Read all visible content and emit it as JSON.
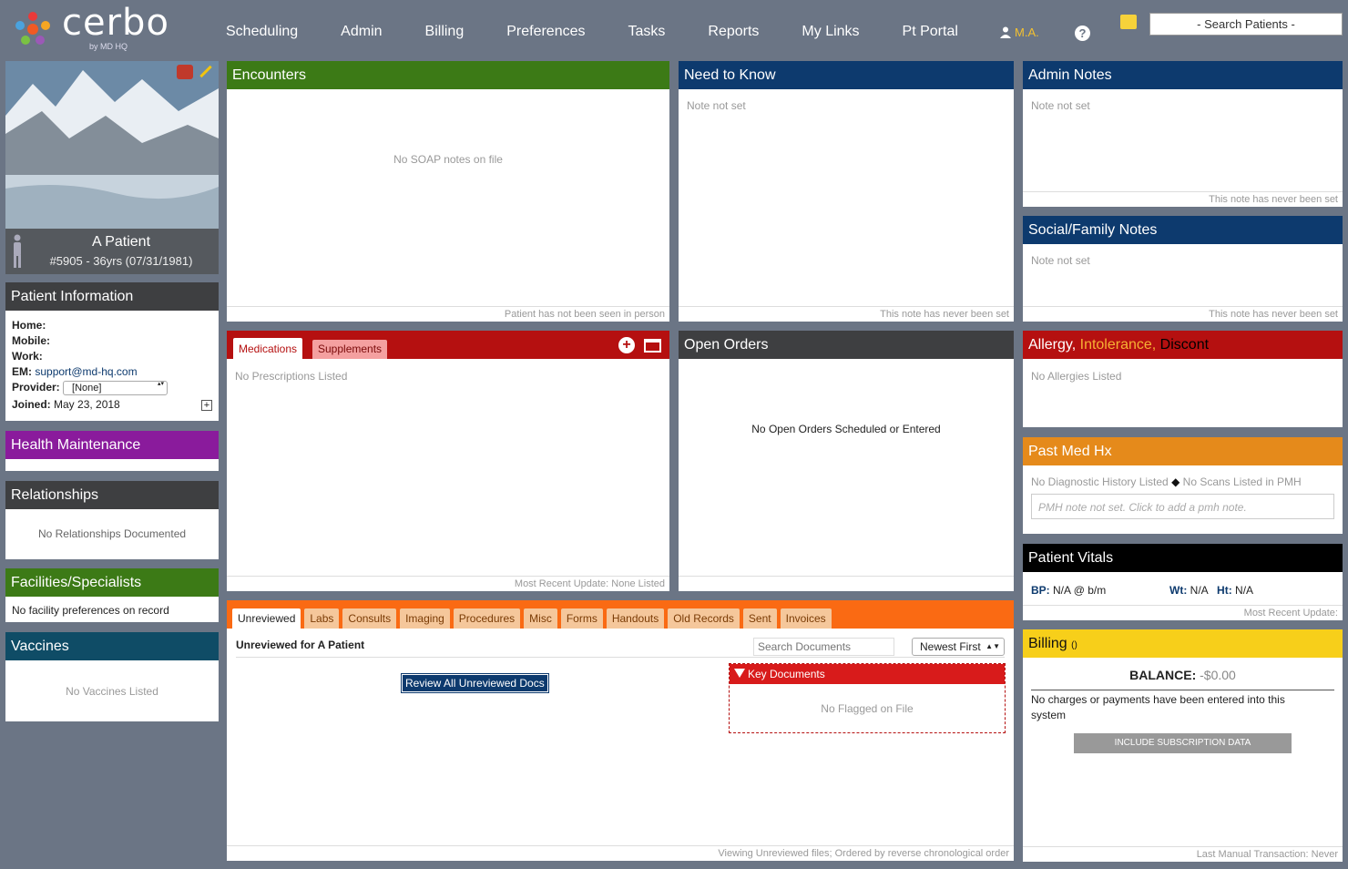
{
  "brand": {
    "name": "cerbo",
    "sub": "by MD HQ"
  },
  "nav": [
    "Scheduling",
    "Admin",
    "Billing",
    "Preferences",
    "Tasks",
    "Reports",
    "My Links",
    "Pt Portal"
  ],
  "user": "M.A.",
  "help": "?",
  "search_patients": "- Search Patients -",
  "patient": {
    "name": "A Patient",
    "id_line": "#5905 - 36yrs (07/31/1981)"
  },
  "patient_info": {
    "title": "Patient Information",
    "home_label": "Home:",
    "mobile_label": "Mobile:",
    "work_label": "Work:",
    "em_label": "EM:",
    "em_value": "support@md-hq.com",
    "provider_label": "Provider:",
    "provider_value": "[None]",
    "joined_label": "Joined:",
    "joined_value": "May 23, 2018"
  },
  "health_maintenance": {
    "title": "Health Maintenance"
  },
  "relationships": {
    "title": "Relationships",
    "empty": "No Relationships Documented"
  },
  "facilities": {
    "title": "Facilities/Specialists",
    "empty": "No facility preferences on record"
  },
  "vaccines": {
    "title": "Vaccines",
    "empty": "No Vaccines Listed"
  },
  "encounters": {
    "title": "Encounters",
    "empty": "No SOAP notes on file",
    "footer": "Patient has not been seen in person"
  },
  "need_to_know": {
    "title": "Need to Know",
    "note": "Note not set",
    "footer": "This note has never been set"
  },
  "admin_notes": {
    "title": "Admin Notes",
    "note": "Note not set",
    "footer": "This note has never been set"
  },
  "social_notes": {
    "title": "Social/Family Notes",
    "note": "Note not set",
    "footer": "This note has never been set"
  },
  "medications": {
    "tab_meds": "Medications",
    "tab_supp": "Supplements",
    "empty": "No Prescriptions Listed",
    "footer": "Most Recent Update: None Listed"
  },
  "open_orders": {
    "title": "Open Orders",
    "empty": "No Open Orders Scheduled or Entered"
  },
  "allergy": {
    "t1": "Allergy,",
    "t2": " Intolerance,",
    "t3": " Discont",
    "empty": "No Allergies Listed"
  },
  "pmh": {
    "title": "Past Med Hx",
    "line1": "No Diagnostic History Listed",
    "line2": "No Scans Listed in PMH",
    "placeholder": "PMH note not set. Click to add a pmh note."
  },
  "vitals": {
    "title": "Patient Vitals",
    "bp_label": "BP:",
    "bp_value": "N/A @ b/m",
    "wt_label": "Wt:",
    "wt_value": "N/A",
    "ht_label": "Ht:",
    "ht_value": "N/A",
    "footer": "Most Recent Update:"
  },
  "billing": {
    "title": "Billing",
    "count": "()",
    "balance_label": "BALANCE:",
    "balance_value": "-$0.00",
    "note": "No charges or payments have been entered into this system",
    "button": "INCLUDE SUBSCRIPTION DATA",
    "footer": "Last Manual Transaction: Never"
  },
  "documents": {
    "tabs": [
      "Unreviewed",
      "Labs",
      "Consults",
      "Imaging",
      "Procedures",
      "Misc",
      "Forms",
      "Handouts",
      "Old Records",
      "Sent",
      "Invoices"
    ],
    "heading": "Unreviewed for A Patient",
    "search_placeholder": "Search Documents",
    "sort": "Newest First",
    "review_button": "Review All Unreviewed Docs",
    "key_title": "Key Documents",
    "key_empty": "No Flagged on File",
    "footer": "Viewing Unreviewed files; Ordered by reverse chronological order"
  },
  "colors": {
    "green": "#3c7a16",
    "navy": "#0d3a6e",
    "red": "#b51010",
    "orange": "#e58a1b",
    "purple": "#8a1b9c",
    "yellow": "#f7cf1a"
  }
}
